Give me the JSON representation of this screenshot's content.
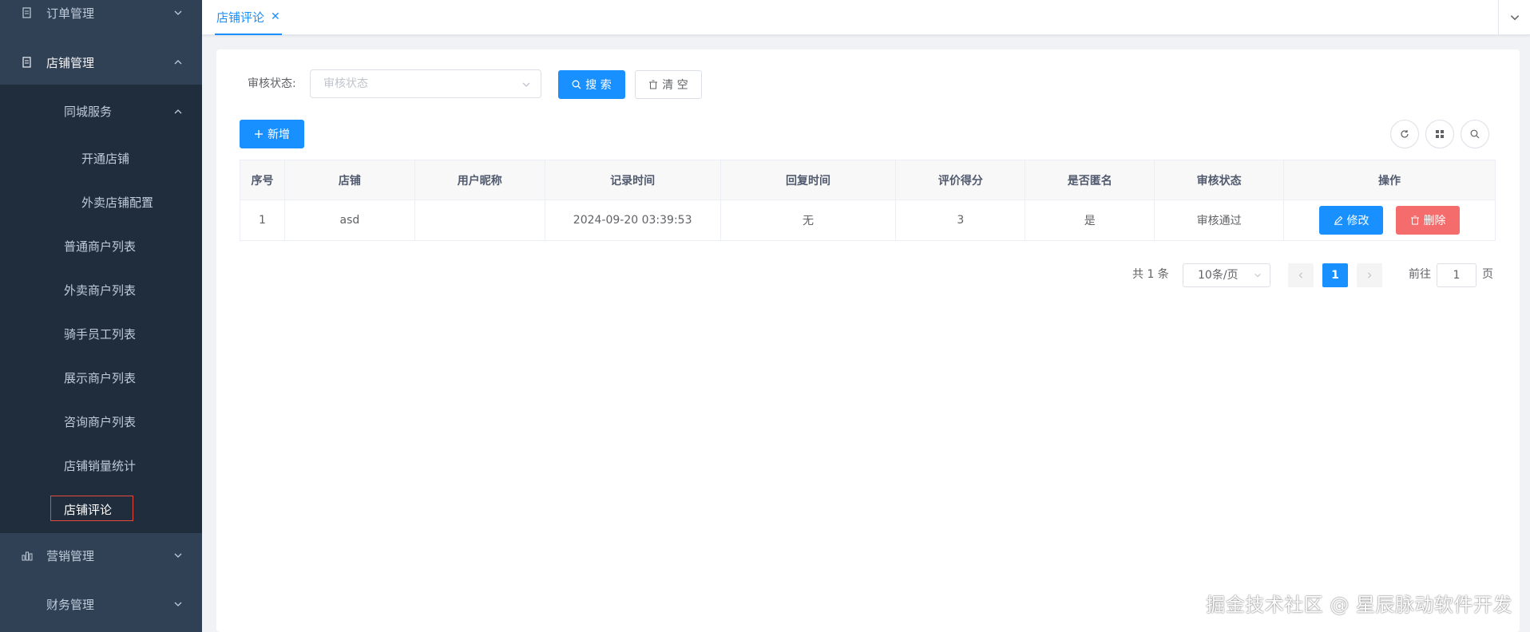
{
  "sidebar": {
    "menus": [
      {
        "label": "订单管理",
        "icon": "document-icon"
      },
      {
        "label": "店铺管理",
        "icon": "document-icon"
      },
      {
        "label": "营销管理",
        "icon": "bar-chart-icon"
      },
      {
        "label": "财务管理",
        "icon": ""
      }
    ],
    "submenu_group": {
      "label": "同城服务"
    },
    "group_items": [
      "开通店铺",
      "外卖店铺配置"
    ],
    "items": [
      "普通商户列表",
      "外卖商户列表",
      "骑手员工列表",
      "展示商户列表",
      "咨询商户列表",
      "店铺销量统计",
      "店铺评论"
    ]
  },
  "tabs": [
    {
      "label": "店铺评论",
      "close": "✕"
    }
  ],
  "filter": {
    "label": "审核状态:",
    "placeholder": "审核状态",
    "search_label": "搜 索",
    "clear_label": "清 空"
  },
  "toolbar": {
    "add_label": "新增"
  },
  "table": {
    "headers": [
      "序号",
      "店铺",
      "用户昵称",
      "记录时间",
      "回复时间",
      "评价得分",
      "是否匿名",
      "审核状态",
      "操作"
    ],
    "rows": [
      {
        "index": "1",
        "shop": "asd",
        "nickname": "",
        "record_time": "2024-09-20 03:39:53",
        "reply_time": "无",
        "score": "3",
        "anonymous": "是",
        "status": "审核通过"
      }
    ],
    "edit_label": "修改",
    "delete_label": "删除"
  },
  "pagination": {
    "total": "共 1 条",
    "page_size": "10条/页",
    "current_page": "1",
    "goto_label": "前往",
    "goto_value": "1",
    "page_suffix": "页"
  },
  "watermark": "掘金技术社区 @ 星辰脉动软件开发",
  "colors": {
    "sidebar": "#304156",
    "submenu": "#1f2d3d",
    "primary": "#1890ff",
    "danger": "#f56c6c"
  }
}
